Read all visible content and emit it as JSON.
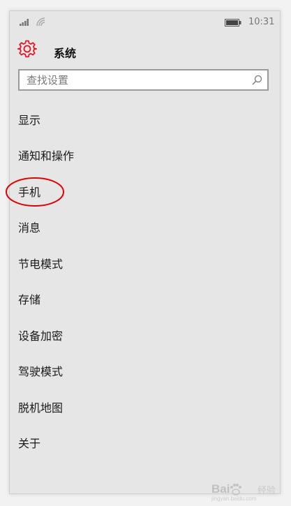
{
  "status_bar": {
    "time": "10:31",
    "signal_icon": "signal-bars-icon",
    "wifi_icon": "wifi-icon",
    "battery_icon": "battery-icon"
  },
  "header": {
    "title": "系统",
    "icon": "gear-icon",
    "accent_color": "#e81123"
  },
  "search": {
    "placeholder": "查找设置",
    "icon": "search-icon"
  },
  "menu": {
    "items": [
      {
        "label": "显示"
      },
      {
        "label": "通知和操作"
      },
      {
        "label": "手机",
        "highlighted": true
      },
      {
        "label": "消息"
      },
      {
        "label": "节电模式"
      },
      {
        "label": "存储"
      },
      {
        "label": "设备加密"
      },
      {
        "label": "驾驶模式"
      },
      {
        "label": "脱机地图"
      },
      {
        "label": "关于"
      }
    ]
  },
  "annotation": {
    "circle_color": "#e00000"
  },
  "watermark": {
    "brand": "Bai",
    "label": "经验",
    "url": "jingyan.baidu.com"
  }
}
